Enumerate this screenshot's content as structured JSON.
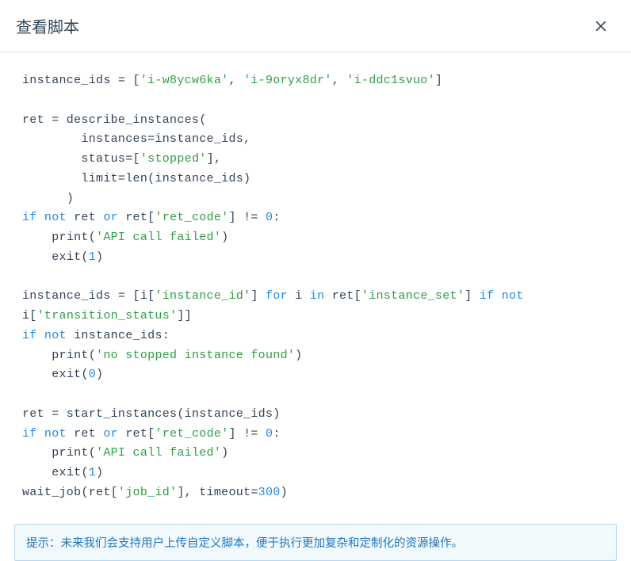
{
  "dialog": {
    "title": "查看脚本",
    "close_icon": "close-icon"
  },
  "code": {
    "tokens": [
      {
        "t": "instance_ids = ["
      },
      {
        "t": "'i-w8ycw6ka'",
        "c": "str"
      },
      {
        "t": ", "
      },
      {
        "t": "'i-9oryx8dr'",
        "c": "str"
      },
      {
        "t": ", "
      },
      {
        "t": "'i-ddc1svuo'",
        "c": "str"
      },
      {
        "t": "]\n\n"
      },
      {
        "t": "ret = describe_instances(\n"
      },
      {
        "t": "        instances=instance_ids,\n"
      },
      {
        "t": "        status=["
      },
      {
        "t": "'stopped'",
        "c": "str"
      },
      {
        "t": "],\n"
      },
      {
        "t": "        limit=len(instance_ids)\n"
      },
      {
        "t": "      )\n"
      },
      {
        "t": "if",
        "c": "kw"
      },
      {
        "t": " "
      },
      {
        "t": "not",
        "c": "kw"
      },
      {
        "t": " ret "
      },
      {
        "t": "or",
        "c": "kw"
      },
      {
        "t": " ret["
      },
      {
        "t": "'ret_code'",
        "c": "str"
      },
      {
        "t": "] != "
      },
      {
        "t": "0",
        "c": "num"
      },
      {
        "t": ":\n"
      },
      {
        "t": "    print("
      },
      {
        "t": "'API call failed'",
        "c": "str"
      },
      {
        "t": ")\n"
      },
      {
        "t": "    exit("
      },
      {
        "t": "1",
        "c": "num"
      },
      {
        "t": ")\n\n"
      },
      {
        "t": "instance_ids = [i["
      },
      {
        "t": "'instance_id'",
        "c": "str"
      },
      {
        "t": "] "
      },
      {
        "t": "for",
        "c": "kw"
      },
      {
        "t": " i "
      },
      {
        "t": "in",
        "c": "kw"
      },
      {
        "t": " ret["
      },
      {
        "t": "'instance_set'",
        "c": "str"
      },
      {
        "t": "] "
      },
      {
        "t": "if",
        "c": "kw"
      },
      {
        "t": " "
      },
      {
        "t": "not",
        "c": "kw"
      },
      {
        "t": " i["
      },
      {
        "t": "'transition_status'",
        "c": "str"
      },
      {
        "t": "]]\n"
      },
      {
        "t": "if",
        "c": "kw"
      },
      {
        "t": " "
      },
      {
        "t": "not",
        "c": "kw"
      },
      {
        "t": " instance_ids:\n"
      },
      {
        "t": "    print("
      },
      {
        "t": "'no stopped instance found'",
        "c": "str"
      },
      {
        "t": ")\n"
      },
      {
        "t": "    exit("
      },
      {
        "t": "0",
        "c": "num"
      },
      {
        "t": ")\n\n"
      },
      {
        "t": "ret = start_instances(instance_ids)\n"
      },
      {
        "t": "if",
        "c": "kw"
      },
      {
        "t": " "
      },
      {
        "t": "not",
        "c": "kw"
      },
      {
        "t": " ret "
      },
      {
        "t": "or",
        "c": "kw"
      },
      {
        "t": " ret["
      },
      {
        "t": "'ret_code'",
        "c": "str"
      },
      {
        "t": "] != "
      },
      {
        "t": "0",
        "c": "num"
      },
      {
        "t": ":\n"
      },
      {
        "t": "    print("
      },
      {
        "t": "'API call failed'",
        "c": "str"
      },
      {
        "t": ")\n"
      },
      {
        "t": "    exit("
      },
      {
        "t": "1",
        "c": "num"
      },
      {
        "t": ")\n"
      },
      {
        "t": "wait_job(ret["
      },
      {
        "t": "'job_id'",
        "c": "str"
      },
      {
        "t": "], timeout="
      },
      {
        "t": "300",
        "c": "num"
      },
      {
        "t": ")\n"
      }
    ]
  },
  "tip": {
    "text": "提示：未来我们会支持用户上传自定义脚本，便于执行更加复杂和定制化的资源操作。"
  }
}
